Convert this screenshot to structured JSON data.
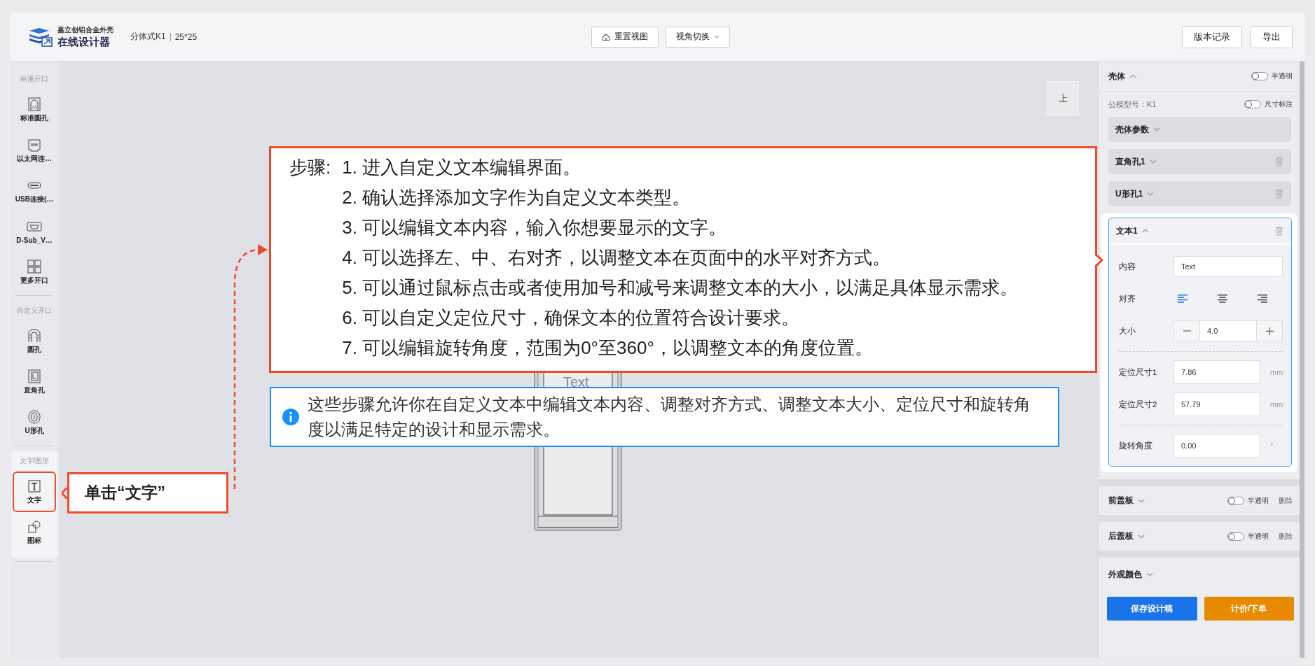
{
  "header": {
    "logo_small": "嘉立创铝合金外壳",
    "logo_big": "在线设计器",
    "model": "分体式K1",
    "size": "25*25",
    "tools": [
      {
        "kind": "home",
        "label": "重置视图"
      },
      {
        "kind": "menu",
        "label": "视角切换"
      }
    ],
    "actions": [
      "版本记录",
      "导出"
    ]
  },
  "sidebar": [
    {
      "title": "标准开口",
      "panel": false,
      "items": [
        {
          "label": "标准圆孔",
          "highlighted": false
        },
        {
          "label": "以太网连…",
          "highlighted": false
        },
        {
          "label": "USB连接(…",
          "highlighted": false
        },
        {
          "label": "D-Sub_V…",
          "highlighted": false
        },
        {
          "label": "更多开口",
          "highlighted": false
        }
      ]
    },
    {
      "title": "自定义开口",
      "panel": false,
      "items": [
        {
          "label": "圆孔",
          "highlighted": false
        },
        {
          "label": "直角孔",
          "highlighted": false
        },
        {
          "label": "U形孔",
          "highlighted": false
        }
      ]
    },
    {
      "title": "文字/图形",
      "panel": true,
      "items": [
        {
          "label": "文字",
          "highlighted": true
        },
        {
          "label": "图标",
          "highlighted": false
        }
      ]
    }
  ],
  "canvas": {
    "view_label": "上",
    "preview_text": "Text"
  },
  "guide": {
    "prefix": "步骤:",
    "steps": [
      "1. 进入自定义文本编辑界面。",
      "2. 确认选择添加文字作为自定义文本类型。",
      "3. 可以编辑文本内容，输入你想要显示的文字。",
      "4. 可以选择左、中、右对齐，以调整文本在页面中的水平对齐方式。",
      "5. 可以通过鼠标点击或者使用加号和减号来调整文本的大小，以满足具体显示需求。",
      "6. 可以自定义定位尺寸，确保文本的位置符合设计要求。",
      "7. 可以编辑旋转角度，范围为0°至360°，以调整文本的角度位置。"
    ],
    "note": "这些步骤允许你在自定义文本中编辑文本内容、调整对齐方式、调整文本大小、定位尺寸和旋转角度以满足特定的设计和显示需求。",
    "click_hint": "单击“文字”"
  },
  "panel": {
    "shell": {
      "title": "壳体",
      "expanded": true,
      "toggle_label": "半透明",
      "on": false
    },
    "model": {
      "label": "公模型号：K1",
      "toggle_label": "尺寸标注",
      "on": false
    },
    "sections": [
      {
        "title": "壳体参数",
        "expanded": false,
        "deletable": false
      },
      {
        "title": "直角孔1",
        "expanded": false,
        "deletable": true
      },
      {
        "title": "U形孔1",
        "expanded": false,
        "deletable": true
      }
    ],
    "text_item": {
      "title": "文本1",
      "expanded": true,
      "content_label": "内容",
      "content": "Text",
      "align_label": "对齐",
      "align": [
        {
          "kind": "left",
          "selected": true
        },
        {
          "kind": "center",
          "selected": false
        },
        {
          "kind": "right",
          "selected": false
        }
      ],
      "size_label": "大小",
      "size": "4.0",
      "positions": [
        {
          "label": "定位尺寸1",
          "value": "7.86",
          "unit": "mm"
        },
        {
          "label": "定位尺寸2",
          "value": "57.79",
          "unit": "mm"
        }
      ],
      "rotation": {
        "label": "旋转角度",
        "value": "0.00",
        "unit": "°"
      }
    },
    "covers": [
      {
        "title": "前盖板",
        "expanded": false,
        "toggle_label": "半透明",
        "on": false,
        "delete_label": "删除"
      },
      {
        "title": "后盖板",
        "expanded": false,
        "toggle_label": "半透明",
        "on": false,
        "delete_label": "删除"
      }
    ],
    "appearance": {
      "title": "外观颜色",
      "expanded": false
    },
    "save": "保存设计稿",
    "order": "计价/下单"
  }
}
